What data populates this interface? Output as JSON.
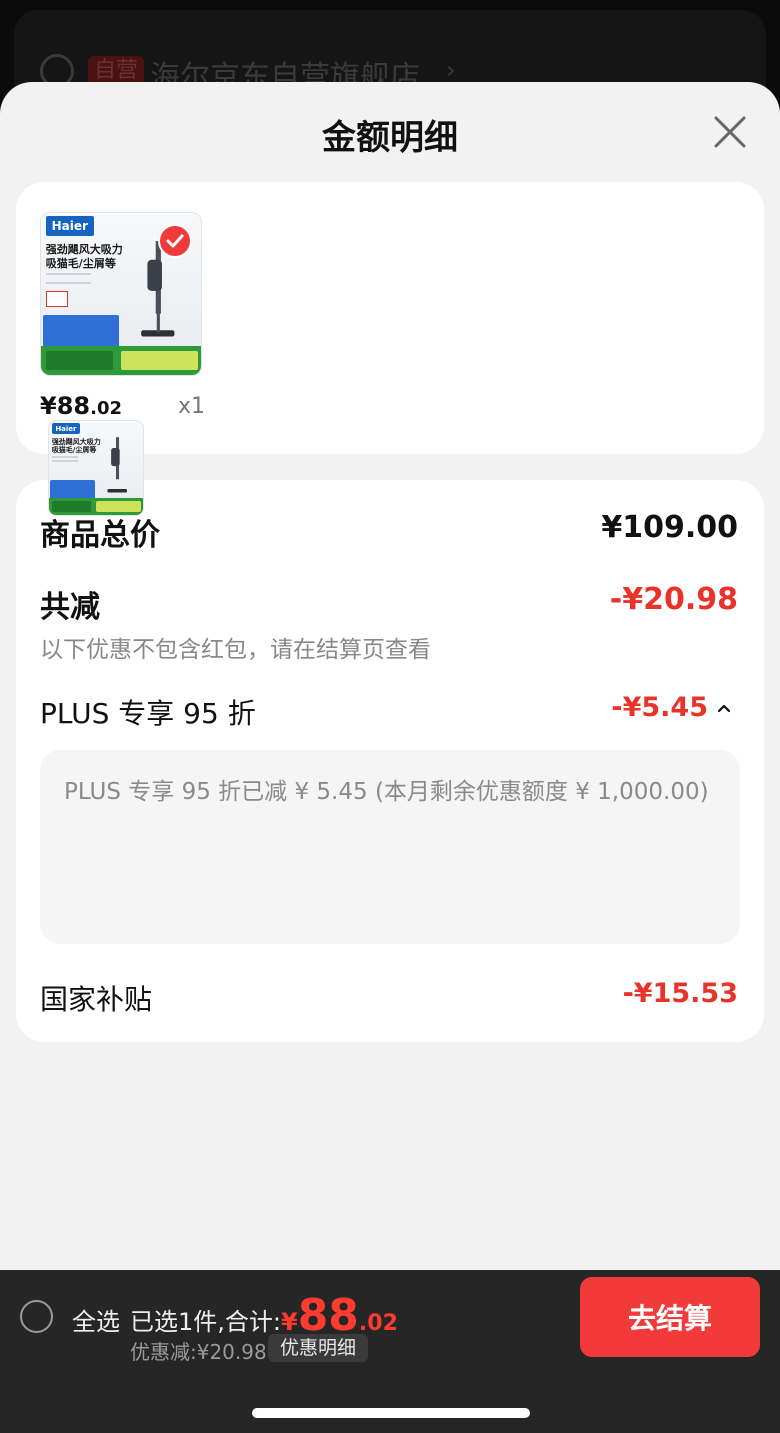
{
  "background": {
    "badge": "自营",
    "store_name": "海尔京东自营旗舰店",
    "chevron": "›"
  },
  "sheet": {
    "title": "金额明细",
    "close_icon": "close-icon"
  },
  "product": {
    "image_brand": "Haier",
    "image_headline_1": "强劲飓风大吸力",
    "image_headline_2": "吸猫毛/尘屑等",
    "price_int": "¥88",
    "price_dec": ".02",
    "quantity": "x1",
    "selected": true
  },
  "amount": {
    "subtotal_label": "商品总价",
    "subtotal_value": "¥109.00",
    "reduction_label": "共减",
    "reduction_value": "-¥20.98",
    "note": "以下优惠不包含红包，请在结算页查看",
    "plus_label": "PLUS 专享 95 折",
    "plus_value": "-¥5.45",
    "plus_detail": "PLUS 专享 95 折已减 ¥ 5.45 (本月剩余优惠额度 ¥ 1,000.00)",
    "subsidy_label": "国家补贴",
    "subsidy_value": "-¥15.53"
  },
  "bottom_bar": {
    "select_all": "全选",
    "selected_text": "已选1件,合计:",
    "total_symbol": "¥",
    "total_int": "88",
    "total_dec": ".02",
    "discount_text": "优惠减:¥20.98",
    "detail_button": "优惠明细",
    "checkout_button": "去结算"
  },
  "colors": {
    "accent_red": "#e8332b",
    "checkout_red": "#f23a3a",
    "sheet_bg": "#f2f2f2",
    "bar_bg": "#262626"
  }
}
